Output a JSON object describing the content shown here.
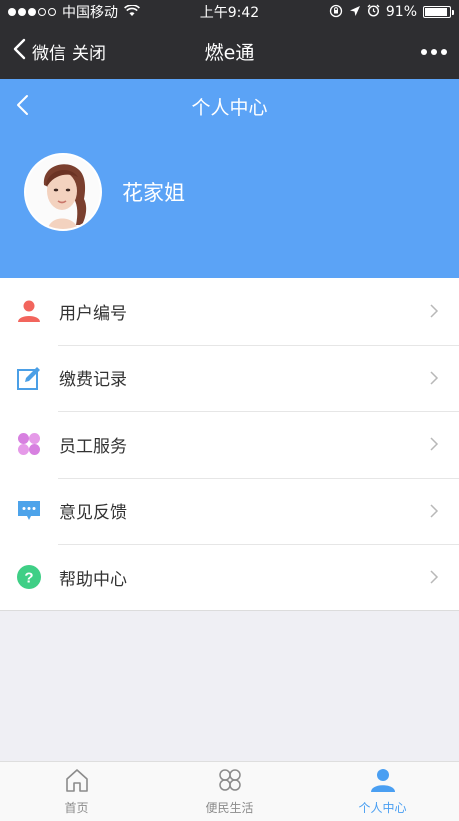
{
  "status_bar": {
    "carrier": "中国移动",
    "time": "上午9:42",
    "battery": "91%",
    "battery_level": 0.91
  },
  "wechat_nav": {
    "back_label": "微信",
    "close_label": "关闭",
    "title": "燃e通"
  },
  "header": {
    "title": "个人中心",
    "username": "花家姐"
  },
  "menu": {
    "items": [
      {
        "label": "用户编号",
        "icon": "user-icon"
      },
      {
        "label": "缴费记录",
        "icon": "edit-icon"
      },
      {
        "label": "员工服务",
        "icon": "clover-icon"
      },
      {
        "label": "意见反馈",
        "icon": "chat-icon"
      },
      {
        "label": "帮助中心",
        "icon": "help-icon"
      }
    ]
  },
  "tabs": [
    {
      "label": "首页",
      "icon": "home-icon",
      "active": false
    },
    {
      "label": "便民生活",
      "icon": "flower-icon",
      "active": false
    },
    {
      "label": "个人中心",
      "icon": "person-icon",
      "active": true
    }
  ],
  "colors": {
    "header_bg": "#5ba3f6",
    "nav_bg": "#2e2e31",
    "active_tab": "#4a9ff2"
  }
}
